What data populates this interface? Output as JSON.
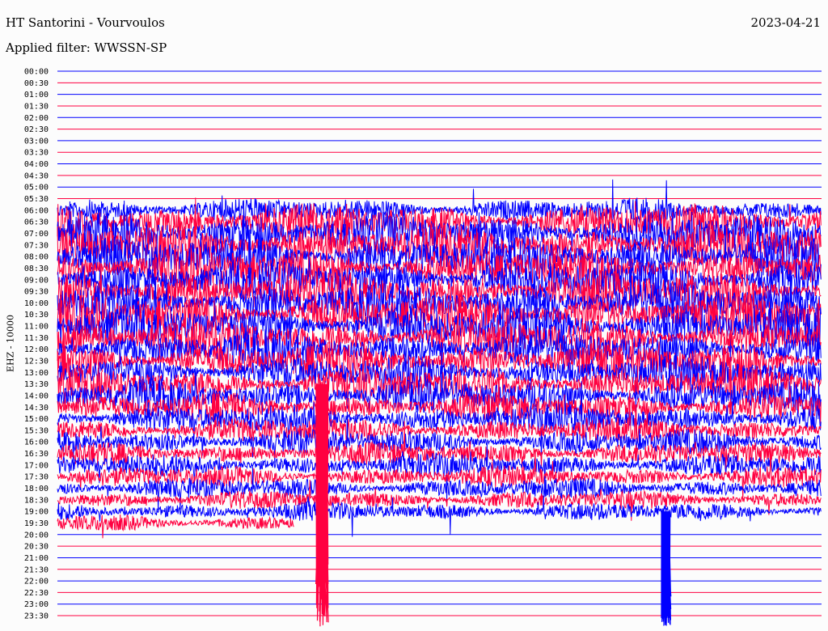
{
  "header": {
    "station": "HT Santorini - Vourvoulos",
    "filter": "Applied filter: WWSSN-SP",
    "date": "2023-04-21"
  },
  "chart_data": {
    "type": "line",
    "title": "HT Santorini - Vourvoulos",
    "ylabel": "EHZ - 10000",
    "xlabel": "",
    "row_interval_minutes": 30,
    "colors": {
      "even": "#0000ff",
      "odd": "#ff0040"
    },
    "rows": [
      {
        "label": "00:00",
        "amp": 0
      },
      {
        "label": "00:30",
        "amp": 0
      },
      {
        "label": "01:00",
        "amp": 0
      },
      {
        "label": "01:30",
        "amp": 0
      },
      {
        "label": "02:00",
        "amp": 0
      },
      {
        "label": "02:30",
        "amp": 0
      },
      {
        "label": "03:00",
        "amp": 0
      },
      {
        "label": "03:30",
        "amp": 0
      },
      {
        "label": "04:00",
        "amp": 0
      },
      {
        "label": "04:30",
        "amp": 0
      },
      {
        "label": "05:00",
        "amp": 0
      },
      {
        "label": "05:30",
        "amp": 0
      },
      {
        "label": "06:00",
        "amp": 0.6
      },
      {
        "label": "06:30",
        "amp": 0.9
      },
      {
        "label": "07:00",
        "amp": 1.0
      },
      {
        "label": "07:30",
        "amp": 1.0
      },
      {
        "label": "08:00",
        "amp": 1.0
      },
      {
        "label": "08:30",
        "amp": 1.0
      },
      {
        "label": "09:00",
        "amp": 1.0
      },
      {
        "label": "09:30",
        "amp": 1.0
      },
      {
        "label": "10:00",
        "amp": 1.0
      },
      {
        "label": "10:30",
        "amp": 1.0
      },
      {
        "label": "11:00",
        "amp": 1.0
      },
      {
        "label": "11:30",
        "amp": 0.9
      },
      {
        "label": "12:00",
        "amp": 0.9
      },
      {
        "label": "12:30",
        "amp": 0.9
      },
      {
        "label": "13:00",
        "amp": 0.8
      },
      {
        "label": "13:30",
        "amp": 0.8
      },
      {
        "label": "14:00",
        "amp": 0.8
      },
      {
        "label": "14:30",
        "amp": 0.7
      },
      {
        "label": "15:00",
        "amp": 0.7
      },
      {
        "label": "15:30",
        "amp": 0.6
      },
      {
        "label": "16:00",
        "amp": 0.6
      },
      {
        "label": "16:30",
        "amp": 0.55
      },
      {
        "label": "17:00",
        "amp": 0.55
      },
      {
        "label": "17:30",
        "amp": 0.5
      },
      {
        "label": "18:00",
        "amp": 0.5
      },
      {
        "label": "18:30",
        "amp": 0.45
      },
      {
        "label": "19:00",
        "amp": 0.45
      },
      {
        "label": "19:30",
        "amp": 0.4,
        "end_fraction": 0.31
      },
      {
        "label": "20:00",
        "amp": 0
      },
      {
        "label": "20:30",
        "amp": 0
      },
      {
        "label": "21:00",
        "amp": 0
      },
      {
        "label": "21:30",
        "amp": 0
      },
      {
        "label": "22:00",
        "amp": 0
      },
      {
        "label": "22:30",
        "amp": 0
      },
      {
        "label": "23:00",
        "amp": 0
      },
      {
        "label": "23:30",
        "amp": 0
      }
    ],
    "events": [
      {
        "row": "13:30",
        "minute": 10.4,
        "color": "#ff0040",
        "rows_span": 21
      },
      {
        "row": "19:00",
        "minute": 23.9,
        "color": "#0000ff",
        "rows_span": 10
      }
    ]
  }
}
